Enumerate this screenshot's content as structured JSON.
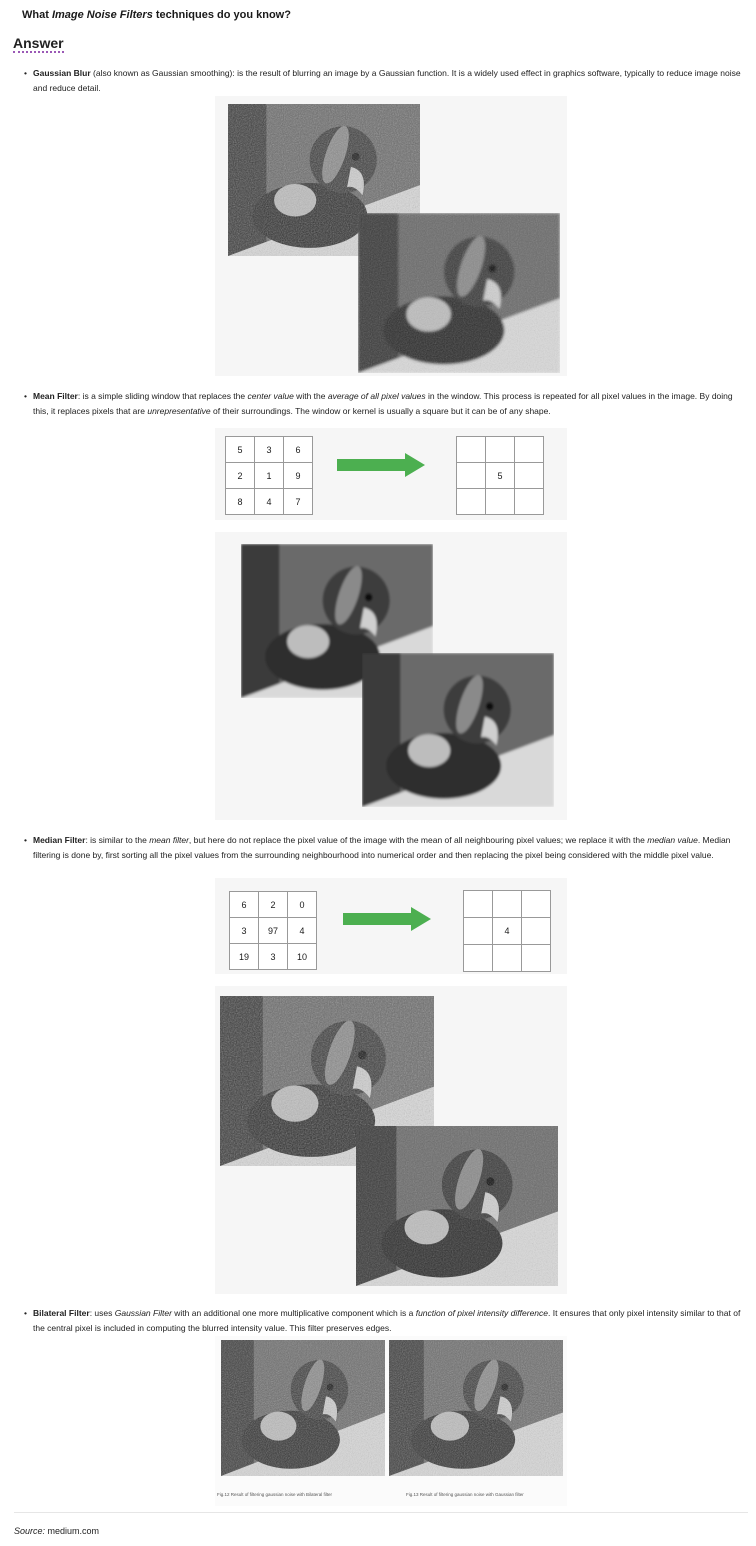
{
  "question": {
    "prefix": "What ",
    "em": "Image Noise Filters",
    "suffix": " techniques do you know?"
  },
  "answer_heading": "Answer",
  "bullets": {
    "gaussian": {
      "title": "Gaussian Blur",
      "text": " (also known as Gaussian smoothing): is the result of blurring an image by a Gaussian function. It is a widely used effect in graphics software, typically to reduce image noise and reduce detail."
    },
    "mean": {
      "title": "Mean Filter",
      "t1": ": is a simple sliding window that replaces the ",
      "e1": "center value",
      "t2": " with the ",
      "e2": "average of all pixel values",
      "t3": " in the window. This process is repeated for all pixel values in the image. By doing this, it replaces pixels that are ",
      "e3": "unrepresentative",
      "t4": " of their surroundings. The window or kernel is usually a square but it can be of any shape."
    },
    "median": {
      "title": "Median Filter",
      "t1": ": is similar to the ",
      "e1": "mean filter",
      "t2": ", but here do not replace the pixel value of the image with the mean of all neighbouring pixel values; we replace it with the ",
      "e2": "median value",
      "t3": ". Median filtering is done by, first sorting all the pixel values from the surrounding neighbourhood into numerical order and then replacing the pixel being considered with the middle pixel value."
    },
    "bilateral": {
      "title": "Bilateral Filter",
      "t1": ": uses ",
      "e1": "Gaussian Filter",
      "t2": " with an additional one more multiplicative component which is a ",
      "e2": "function of pixel intensity difference",
      "t3": ". It ensures that only pixel intensity similar to that of the central pixel is included in computing the blurred intensity value. This filter preserves edges."
    }
  },
  "mean_grid": {
    "input": [
      [
        "5",
        "3",
        "6"
      ],
      [
        "2",
        "1",
        "9"
      ],
      [
        "8",
        "4",
        "7"
      ]
    ],
    "output_center": "5"
  },
  "median_grid": {
    "input": [
      [
        "6",
        "2",
        "0"
      ],
      [
        "3",
        "97",
        "4"
      ],
      [
        "19",
        "3",
        "10"
      ]
    ],
    "output_center": "4"
  },
  "captions": {
    "left": "Fig.12 Result of filtering gaussian noise with Bilateral filter",
    "right": "Fig.13 Result of filtering gaussian noise with Gaussian filter"
  },
  "source": {
    "label": "Source:",
    "value": " medium.com"
  },
  "colors": {
    "arrow": "#4caf50",
    "panel": "#f6f6f6"
  }
}
